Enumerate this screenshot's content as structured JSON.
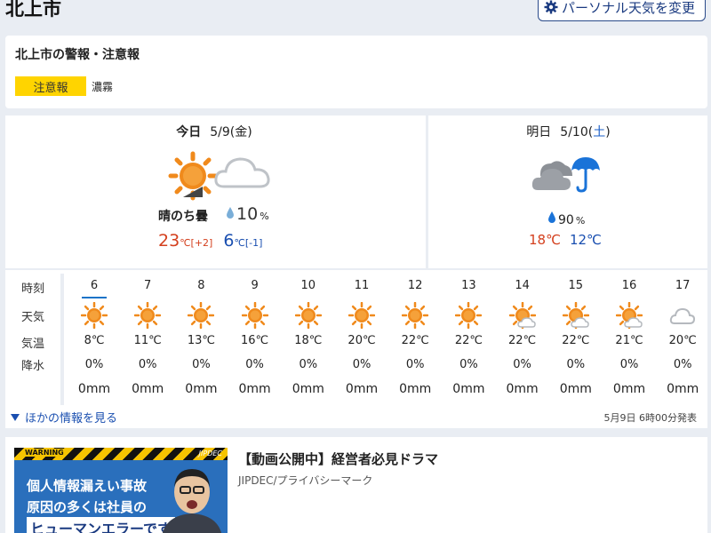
{
  "header": {
    "city": "北上市",
    "personal_button": "パーソナル天気を変更"
  },
  "alerts": {
    "title": "北上市の警報・注意報",
    "badge": "注意報",
    "text": "濃霧"
  },
  "today": {
    "label": "今日",
    "date": "5/9",
    "dow_open": "(",
    "dow": "金",
    "dow_close": ")",
    "weather": "晴のち曇",
    "rain_value": "10",
    "rain_unit": "%",
    "high": "23",
    "high_unit": "℃",
    "high_diff": "[+2]",
    "low": "6",
    "low_unit": "℃",
    "low_diff": "[-1]"
  },
  "tomorrow": {
    "label": "明日",
    "date": "5/10",
    "dow_open": "(",
    "dow": "土",
    "dow_close": ")",
    "rain": "90",
    "rain_unit": "%",
    "high": "18",
    "low": "12",
    "temp_unit": "℃"
  },
  "hourly": {
    "labels": {
      "time": "時刻",
      "weather": "天気",
      "temp": "気温",
      "precip": "降水"
    },
    "hours": [
      {
        "hour": "6",
        "icon": "sun-icon",
        "temp": "8℃",
        "prob": "0%",
        "amount": "0mm"
      },
      {
        "hour": "7",
        "icon": "sun-icon",
        "temp": "11℃",
        "prob": "0%",
        "amount": "0mm"
      },
      {
        "hour": "8",
        "icon": "sun-icon",
        "temp": "13℃",
        "prob": "0%",
        "amount": "0mm"
      },
      {
        "hour": "9",
        "icon": "sun-icon",
        "temp": "16℃",
        "prob": "0%",
        "amount": "0mm"
      },
      {
        "hour": "10",
        "icon": "sun-icon",
        "temp": "18℃",
        "prob": "0%",
        "amount": "0mm"
      },
      {
        "hour": "11",
        "icon": "sun-icon",
        "temp": "20℃",
        "prob": "0%",
        "amount": "0mm"
      },
      {
        "hour": "12",
        "icon": "sun-icon",
        "temp": "22℃",
        "prob": "0%",
        "amount": "0mm"
      },
      {
        "hour": "13",
        "icon": "sun-icon",
        "temp": "22℃",
        "prob": "0%",
        "amount": "0mm"
      },
      {
        "hour": "14",
        "icon": "sun-cloud-icon",
        "temp": "22℃",
        "prob": "0%",
        "amount": "0mm"
      },
      {
        "hour": "15",
        "icon": "sun-cloud-icon",
        "temp": "22℃",
        "prob": "0%",
        "amount": "0mm"
      },
      {
        "hour": "16",
        "icon": "sun-cloud-icon",
        "temp": "21℃",
        "prob": "0%",
        "amount": "0mm"
      },
      {
        "hour": "17",
        "icon": "cloud-icon",
        "temp": "20℃",
        "prob": "0%",
        "amount": "0mm"
      }
    ]
  },
  "footer": {
    "more_info": "ほかの情報を見る",
    "issued": "5月9日 6時00分発表"
  },
  "ad": {
    "warning": "WARNING",
    "brand": "JIPDEC",
    "line1": "個人情報漏えい事故",
    "line2": "原因の多くは社員の",
    "line3": "ヒューマンエラーです",
    "headline": "【動画公開中】経営者必見ドラマ",
    "sponsor": "JIPDEC/プライバシーマーク"
  },
  "colors": {
    "sun": "#f08a1c",
    "high": "#d4401e",
    "low": "#1a4fb0",
    "badge": "#ffd400"
  }
}
